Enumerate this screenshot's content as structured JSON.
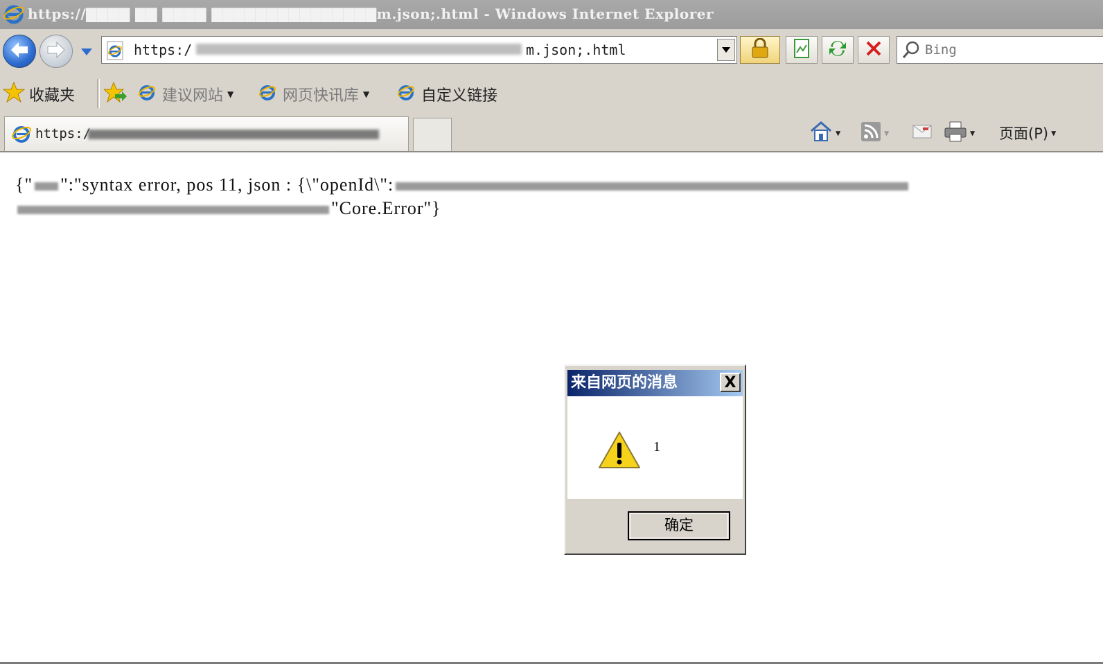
{
  "window": {
    "title": "https://▇▇▇▇ ▇▇ ▇▇▇▇ ▇▇▇▇▇▇▇▇▇▇▇▇▇▇▇m.json;.html - Windows Internet Explorer"
  },
  "address_bar": {
    "prefix": "https:/",
    "suffix": "m.json;.html"
  },
  "search": {
    "placeholder": "Bing"
  },
  "favorites_bar": {
    "favorites_label": "收藏夹",
    "items": [
      {
        "label": "建议网站",
        "has_dropdown": true,
        "muted": true
      },
      {
        "label": "网页快讯库",
        "has_dropdown": true,
        "muted": true
      },
      {
        "label": "自定义链接",
        "has_dropdown": false,
        "muted": false
      }
    ]
  },
  "tab": {
    "title": "https:/"
  },
  "command_bar": {
    "page_menu": "页面(P)"
  },
  "content": {
    "line1_start": "{\"",
    "line1_mid": "\":\"syntax error, pos 11, json : {\\\"openId\\\":",
    "line2_end": "\"Core.Error\"}"
  },
  "dialog": {
    "title": "来自网页的消息",
    "close": "X",
    "message": "1",
    "ok_label": "确定"
  },
  "colors": {
    "chrome": "#d8d4cc",
    "title_bar": "#a9a9a9",
    "dialog_title_start": "#0a246a",
    "dialog_title_end": "#a6caf0"
  }
}
